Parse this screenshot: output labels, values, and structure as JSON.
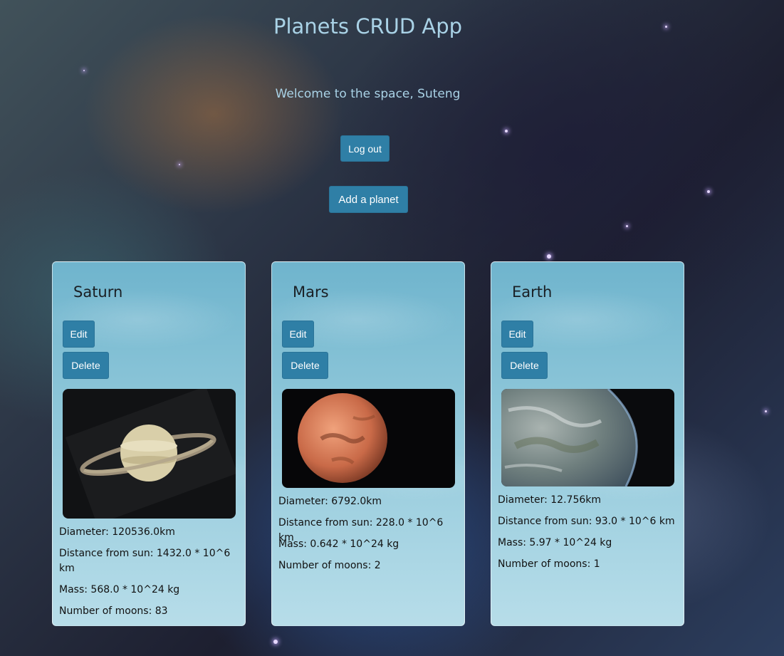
{
  "header": {
    "title": "Planets CRUD App",
    "welcome": "Welcome to the space, Suteng",
    "logout_label": "Log out",
    "add_label": "Add a planet"
  },
  "planets": [
    {
      "name": "Saturn",
      "edit_label": "Edit",
      "delete_label": "Delete",
      "diameter": "Diameter: 120536.0km",
      "distance": "Distance from sun: 1432.0 * 10^6 km",
      "mass": "Mass: 568.0 * 10^24 kg",
      "moons": "Number of moons: 83",
      "image": "saturn-image"
    },
    {
      "name": "Mars",
      "edit_label": "Edit",
      "delete_label": "Delete",
      "diameter": "Diameter: 6792.0km",
      "distance": "Distance from sun: 228.0 * 10^6 km",
      "mass": "Mass: 0.642 * 10^24 kg",
      "moons": "Number of moons: 2",
      "image": "mars-image"
    },
    {
      "name": "Earth",
      "edit_label": "Edit",
      "delete_label": "Delete",
      "diameter": "Diameter: 12.756km",
      "distance": "Distance from sun: 93.0 * 10^6 km",
      "mass": "Mass: 5.97 * 10^24 kg",
      "moons": "Number of moons: 1",
      "image": "earth-image"
    }
  ],
  "colors": {
    "button": "#2f7fa6",
    "title_text": "#a9d2e6",
    "card_top": "#6fb4cd",
    "card_bottom": "#b7dde9"
  }
}
